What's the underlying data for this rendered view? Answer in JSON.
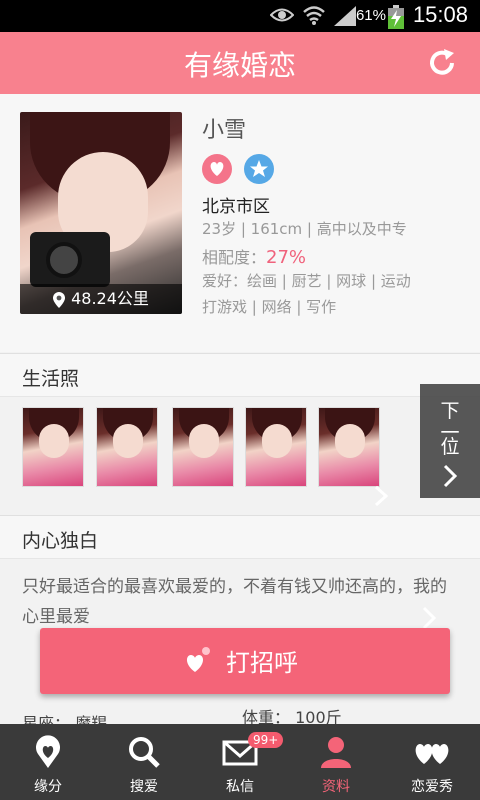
{
  "status": {
    "battery_pct": "61%",
    "time": "15:08"
  },
  "header": {
    "title": "有缘婚恋"
  },
  "profile": {
    "name": "小雪",
    "distance": "48.24公里",
    "city": "北京市区",
    "meta": "23岁 | 161cm | 高中以及中专",
    "match_label": "相配度：",
    "match_value": "27%",
    "hobbies_line1": "爱好：绘画 | 厨艺 | 网球 | 运动",
    "hobbies_line2": "打游戏 | 网络 | 写作"
  },
  "sections": {
    "photos": "生活照",
    "monologue": "内心独白"
  },
  "next_tab": {
    "c1": "下",
    "c2": "一",
    "c3": "位"
  },
  "monologue": {
    "text": "只好最适合的最喜欢最爱的，不着有钱又帅还高的，我的心里最爱"
  },
  "greet_button": {
    "label": "打招呼"
  },
  "extra": {
    "left": "星座：  魔羯",
    "right": "体重：  100斤"
  },
  "tabs": [
    {
      "label": "缘分"
    },
    {
      "label": "搜爱"
    },
    {
      "label": "私信",
      "badge": "99+"
    },
    {
      "label": "资料"
    },
    {
      "label": "恋爱秀"
    }
  ],
  "colors": {
    "accent": "#f8818e",
    "button": "#f46478",
    "tabbar": "#3a3a3a"
  }
}
